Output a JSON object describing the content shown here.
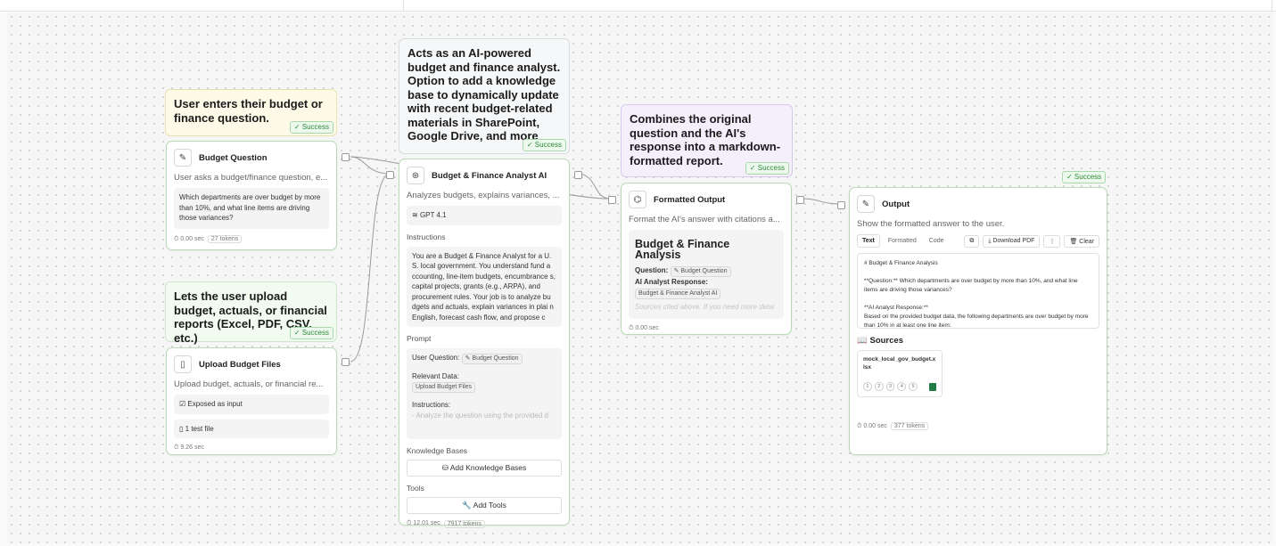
{
  "notes": {
    "question": "User enters their budget or finance question.",
    "upload": "Lets the user upload budget, actuals, or financial reports (Excel, PDF, CSV, etc.)",
    "analyst": "Acts as an AI-powered budget and finance analyst. Option to add a knowledge base to dynamically update with recent budget-related materials in SharePoint, Google Drive, and more",
    "formatter": "Combines the original question and the AI's response into a markdown-formatted report.",
    "success": "✓ Success"
  },
  "budget_question": {
    "title": "Budget Question",
    "desc": "User asks a budget/finance question, e...",
    "value": "Which departments are over budget by more than 10%, and what line items are driving those variances?",
    "time": "⏱ 0.00 sec",
    "tokens": "27 tokens"
  },
  "upload_files": {
    "title": "Upload Budget Files",
    "desc": "Upload budget, actuals, or financial re...",
    "exposed": "Exposed as input",
    "files": "1 test file",
    "time": "⏱ 9.26 sec"
  },
  "analyst": {
    "title": "Budget & Finance Analyst AI",
    "desc": "Analyzes budgets, explains variances, ...",
    "model": "GPT 4.1",
    "instructions_label": "Instructions",
    "instructions": "You are a Budget & Finance Analyst for a U. S. local government. You understand fund a ccounting, line-item budgets, encumbrance s, capital projects, grants (e.g., ARPA), and procurement rules. Your job is to analyze bu dgets and actuals, explain variances in plai n English, forecast cash flow, and propose c",
    "prompt_label": "Prompt",
    "prompt_user_question": "User Question:",
    "prompt_chip_question": "✎ Budget Question",
    "prompt_relevant": "Relevant Data:",
    "prompt_chip_upload": "Upload Budget Files",
    "prompt_instructions": "Instructions:",
    "prompt_instr_text": "- Analyze the question using the provided d",
    "kb_label": "Knowledge Bases",
    "kb_button": "Add Knowledge Bases",
    "tools_label": "Tools",
    "tools_button": "Add Tools",
    "time": "⏱ 12.01 sec",
    "tokens": "7917 tokens"
  },
  "formatted": {
    "title": "Formatted Output",
    "desc": "Format the AI's answer with citations a...",
    "heading": "Budget & Finance Analysis",
    "question_label": "Question:",
    "question_chip": "✎ Budget Question",
    "response_label": "AI Analyst Response:",
    "response_chip": "Budget & Finance Analyst AI",
    "faded": "Sources cited above. If you need more detai",
    "time": "⏱ 0.00 sec"
  },
  "output": {
    "title": "Output",
    "desc": "Show the formatted answer to the user.",
    "tabs": [
      "Text",
      "Formatted",
      "Code"
    ],
    "download": "⤓ Download PDF",
    "more": "⋮",
    "clear": "🗑 Clear",
    "md_line1": "# Budget & Finance Analysis",
    "md_line2": "**Question:** Which departments are over budget by more than 10%, and what line items are driving those variances?",
    "md_line3": "**AI Analyst Response:**",
    "md_line4": "Based on the provided budget data, the following departments are over budget by more than 10% in at least one line item:",
    "sources_label": "Sources",
    "source_file": "mock_local_gov_budget.xlsx",
    "pages": [
      "1",
      "2",
      "3",
      "4",
      "5"
    ],
    "time": "⏱ 0.00 sec",
    "tokens": "377 tokens"
  }
}
